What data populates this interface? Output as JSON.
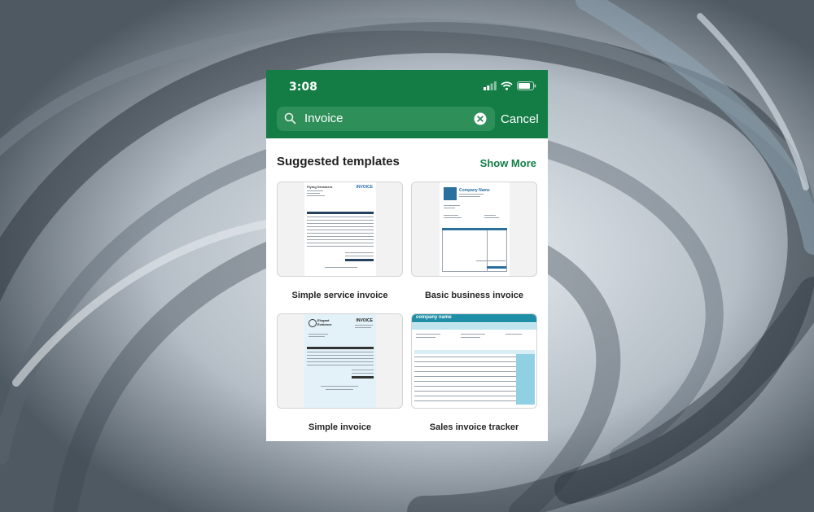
{
  "status_bar": {
    "time": "3:08"
  },
  "search": {
    "query": "Invoice",
    "cancel_label": "Cancel"
  },
  "section": {
    "title": "Suggested templates",
    "show_more_label": "Show More"
  },
  "templates": [
    {
      "label": "Simple service invoice",
      "thumb": {
        "title": "INVOICE",
        "company": "Flying Dreamers"
      }
    },
    {
      "label": "Basic business invoice",
      "thumb": {
        "title": "Company Name",
        "logo": "LOGO\nHERE"
      }
    },
    {
      "label": "Simple invoice",
      "thumb": {
        "title": "INVOICE",
        "company": "Elegant Evidence"
      }
    },
    {
      "label": "Sales invoice tracker",
      "thumb": {
        "title": "company name"
      }
    }
  ],
  "colors": {
    "header_green": "#137d45",
    "accent_green": "#137d45"
  }
}
